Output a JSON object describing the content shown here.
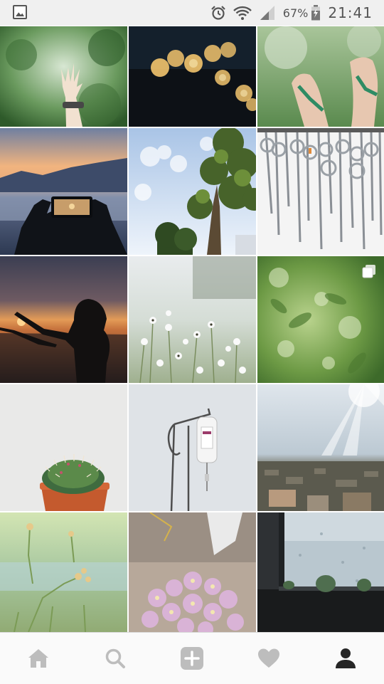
{
  "status_bar": {
    "battery_percent": "67%",
    "time": "21:41",
    "icons": [
      "gallery-icon",
      "alarm-icon",
      "wifi-icon",
      "signal-icon",
      "battery-charging-icon"
    ]
  },
  "grid": {
    "rows": 5,
    "columns": 3,
    "tiles": [
      {
        "subject": "hand-raised-against-trees",
        "multi": false
      },
      {
        "subject": "golden-bokeh-lights",
        "multi": false
      },
      {
        "subject": "feet-in-sandals-greenery",
        "multi": false
      },
      {
        "subject": "phone-photo-of-sunrise-over-clouds",
        "multi": false
      },
      {
        "subject": "tree-against-blue-sky",
        "multi": false
      },
      {
        "subject": "hanging-surgical-scissors",
        "multi": false
      },
      {
        "subject": "silhouette-at-sunset",
        "multi": false
      },
      {
        "subject": "white-wildflowers",
        "multi": false
      },
      {
        "subject": "green-leaves-bokeh",
        "multi": true
      },
      {
        "subject": "cactus-in-pot",
        "multi": false
      },
      {
        "subject": "iv-drip-stand",
        "multi": false
      },
      {
        "subject": "city-skyline-sun-rays",
        "multi": false
      },
      {
        "subject": "meadow-flowers-soft-focus",
        "multi": false
      },
      {
        "subject": "pink-flowers-bouquet",
        "multi": false
      },
      {
        "subject": "rainy-window-cacti",
        "multi": false
      }
    ]
  },
  "bottom_nav": {
    "items": [
      {
        "name": "home",
        "icon": "home-icon",
        "active": false
      },
      {
        "name": "search",
        "icon": "search-icon",
        "active": false
      },
      {
        "name": "add",
        "icon": "add-post-icon",
        "active": false
      },
      {
        "name": "activity",
        "icon": "heart-icon",
        "active": false
      },
      {
        "name": "profile",
        "icon": "profile-icon",
        "active": true
      }
    ],
    "inactive_color": "#bdbdbd",
    "active_color": "#262626"
  }
}
